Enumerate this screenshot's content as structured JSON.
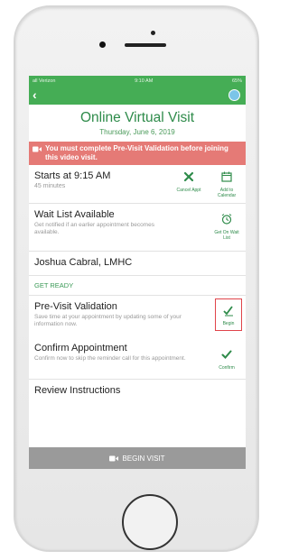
{
  "status_bar": {
    "carrier": "all Verizon",
    "time": "9:10 AM",
    "battery": "65%"
  },
  "header": {
    "title": "Online Virtual Visit",
    "date": "Thursday, June 6, 2019"
  },
  "alert": {
    "text": "You must complete Pre-Visit Validation before joining this video visit."
  },
  "appointment": {
    "starts": "Starts at 9:15 AM",
    "duration": "45 minutes",
    "cancel_label": "Cancel Appt",
    "calendar_label": "Add to Calendar"
  },
  "waitlist": {
    "title": "Wait List Available",
    "desc": "Get notified if an earlier appointment becomes available.",
    "action_label": "Get On Wait List"
  },
  "provider": {
    "name": "Joshua Cabral, LMHC"
  },
  "section": {
    "label": "GET READY"
  },
  "prevalidation": {
    "title": "Pre-Visit Validation",
    "desc": "Save time at your appointment by updating some of your information now.",
    "action_label": "Begin"
  },
  "confirm": {
    "title": "Confirm Appointment",
    "desc": "Confirm now to skip the reminder call for this appointment.",
    "action_label": "Confirm"
  },
  "review": {
    "title": "Review Instructions"
  },
  "footer": {
    "begin_visit_label": "BEGIN VISIT"
  },
  "colors": {
    "primary_green": "#45ad55",
    "alert_red": "#e57a76",
    "button_gray": "#9a9a9a"
  }
}
